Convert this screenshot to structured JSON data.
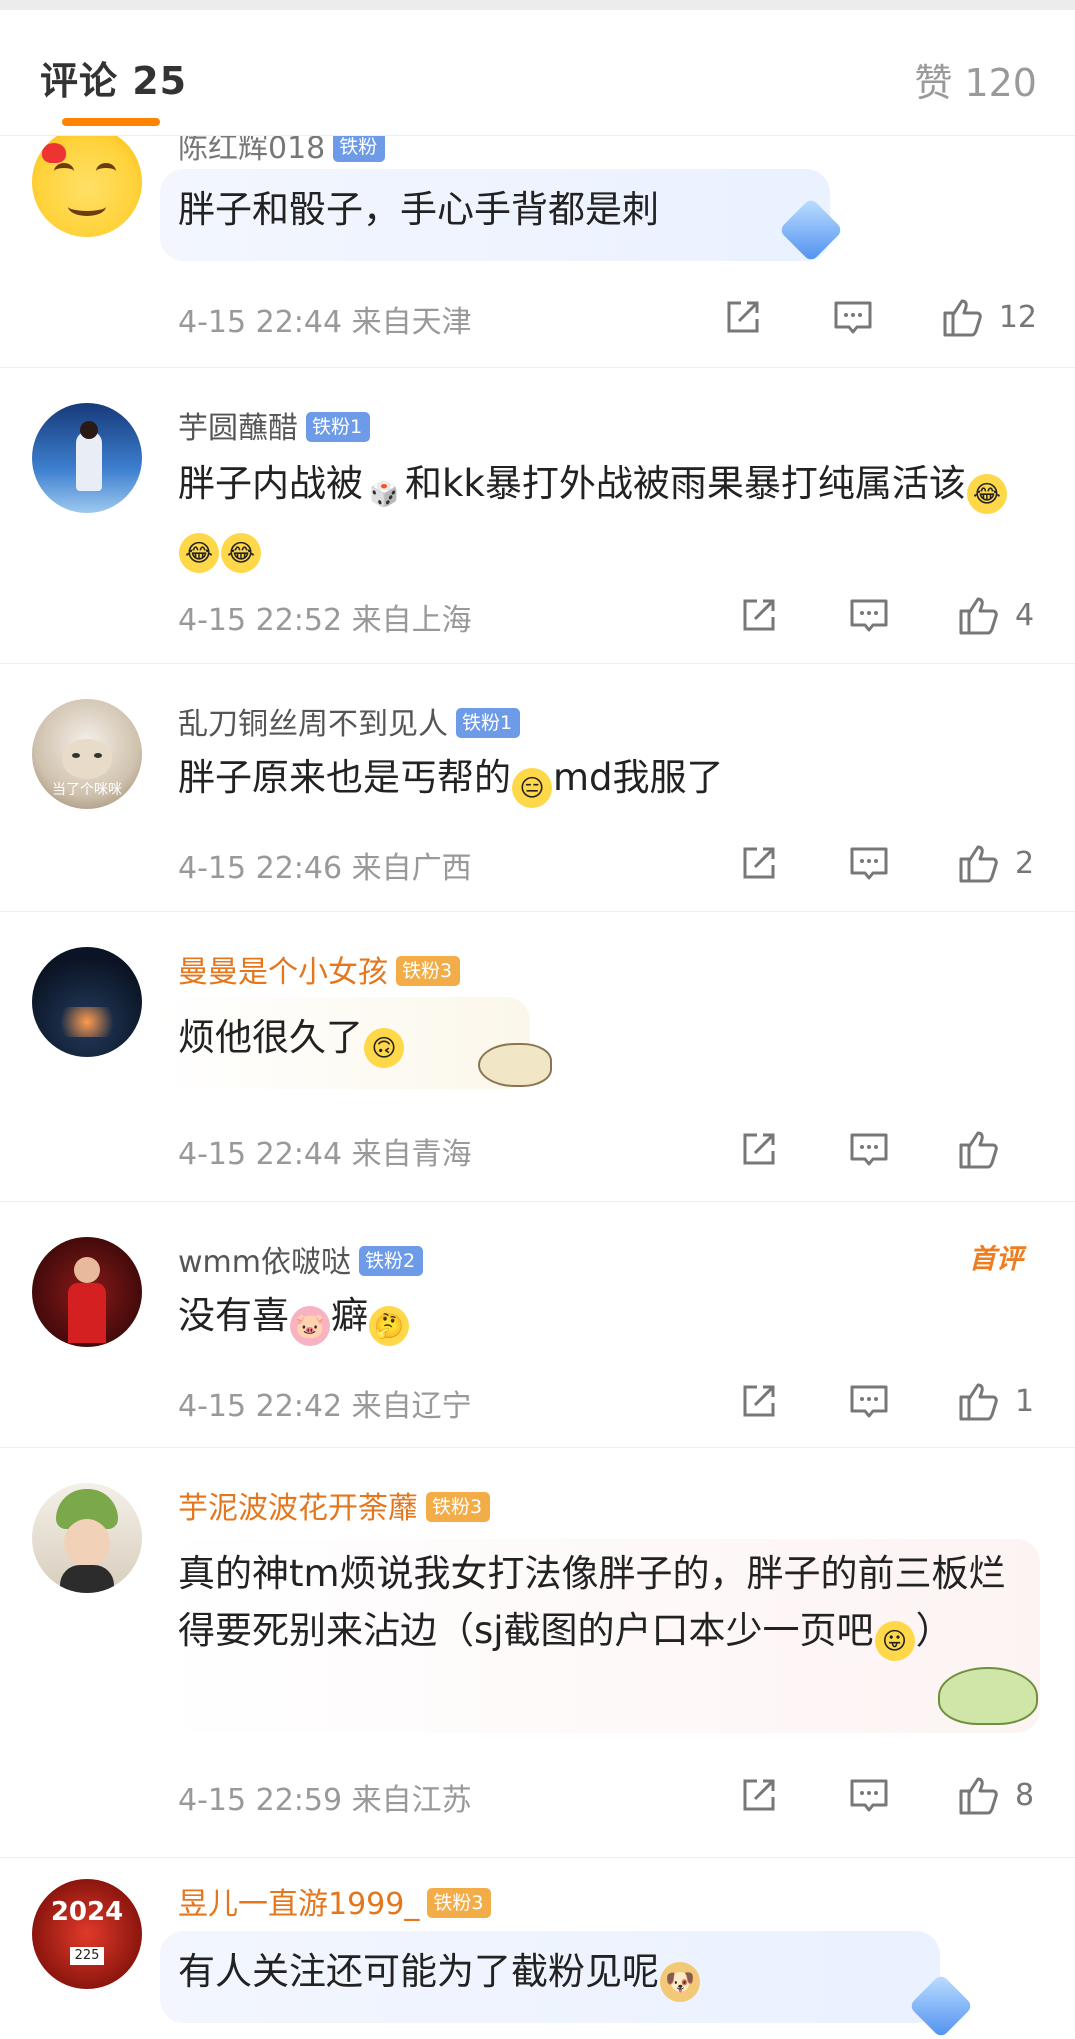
{
  "header": {
    "comments_tab": "评论 25",
    "likes_tab": "赞 120",
    "accent": "#ff8200"
  },
  "comments": [
    {
      "username": "陈红辉018",
      "badge": "铁粉",
      "text": "胖子和骰子，手心手背都是刺",
      "time": "4-15 22:44",
      "location": "来自天津",
      "likes": "12"
    },
    {
      "username": "芋圆蘸醋",
      "badge": "铁粉1",
      "text_a": "胖子内战被",
      "emoji_a": "🎲",
      "text_b": "和kk暴打外战被雨果暴打纯属活该",
      "emojis_end": [
        "😂",
        "😂",
        "😂"
      ],
      "time": "4-15 22:52",
      "location": "来自上海",
      "likes": "4"
    },
    {
      "username": "乱刀铜丝周不到见人",
      "badge": "铁粉1",
      "avatar_text": "当了个咪咪",
      "text_a": "胖子原来也是丐帮的",
      "emoji_a": "😑",
      "text_b": "md我服了",
      "time": "4-15 22:46",
      "location": "来自广西",
      "likes": "2"
    },
    {
      "username": "曼曼是个小女孩",
      "badge": "铁粉3",
      "text": "烦他很久了",
      "emoji": "🙃",
      "time": "4-15 22:44",
      "location": "来自青海",
      "likes": ""
    },
    {
      "username": "wmm依啵哒",
      "badge": "铁粉2",
      "tag": "首评",
      "text_a": "没有喜",
      "emoji_a": "🐷",
      "text_b": "癖",
      "emoji_b": "🤔",
      "time": "4-15 22:42",
      "location": "来自辽宁",
      "likes": "1"
    },
    {
      "username": "芋泥波波花开荼蘼",
      "badge": "铁粉3",
      "text": "真的神tm烦说我女打法像胖子的，胖子的前三板烂得要死别来沾边（sj截图的户口本少一页吧",
      "emoji": "😛",
      "text_end": "）",
      "time": "4-15 22:59",
      "location": "来自江苏",
      "likes": "8"
    },
    {
      "username": "昱儿一直游1999_",
      "badge": "铁粉3",
      "avatar_text": "2024",
      "avatar_num": "225",
      "text": "有人关注还可能为了截粉见呢",
      "emoji": "🐶"
    }
  ]
}
